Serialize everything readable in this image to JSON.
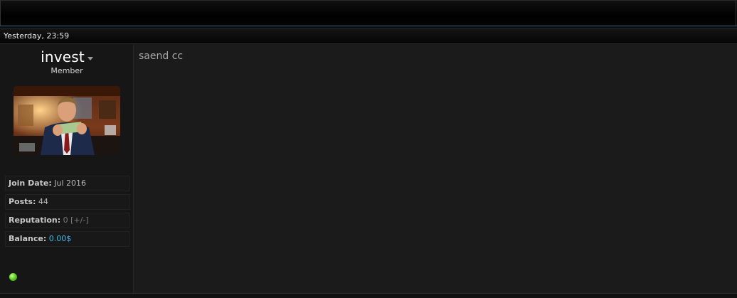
{
  "post": {
    "date": "Yesterday, 23:59",
    "message": "saend cc"
  },
  "user": {
    "name": "invest",
    "title": "Member",
    "online": true
  },
  "stats": {
    "join_label": "Join Date:",
    "join_value": "Jul 2016",
    "posts_label": "Posts:",
    "posts_value": "44",
    "rep_label": "Reputation:",
    "rep_value": "0",
    "rep_action": "[+/-]",
    "balance_label": "Balance:",
    "balance_value": "0.00$"
  },
  "colors": {
    "accent_blue": "#3fb7e6",
    "online_green": "#55c41a",
    "background": "#1a1a1a"
  }
}
